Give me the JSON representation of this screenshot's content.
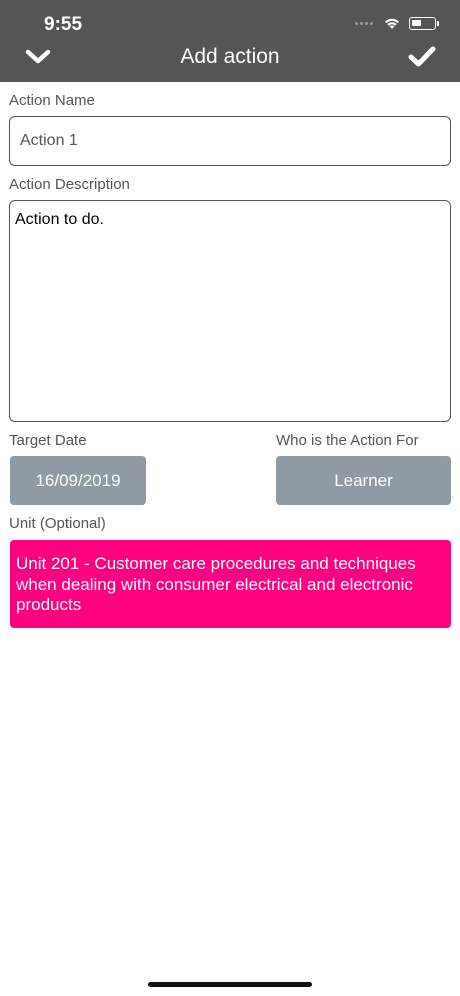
{
  "status_bar": {
    "time": "9:55"
  },
  "header": {
    "title": "Add action",
    "background": "#555555"
  },
  "form": {
    "action_name": {
      "label": "Action Name",
      "value": "Action 1"
    },
    "action_description": {
      "label": "Action Description",
      "value": "Action to do."
    },
    "target_date": {
      "label": "Target Date",
      "value": "16/09/2019"
    },
    "action_for": {
      "label": "Who is the Action For",
      "value": "Learner"
    },
    "unit": {
      "label": "Unit (Optional)",
      "value": "Unit 201 - Customer care procedures and techniques when dealing with consumer electrical and electronic products",
      "color": "#ff0080"
    }
  },
  "colors": {
    "button_gray": "#8f9aa5",
    "accent": "#ff0080"
  },
  "icons": {
    "left_nav": "chevron-down-icon",
    "right_nav": "checkmark-icon",
    "wifi": "wifi-icon",
    "battery": "battery-icon"
  }
}
